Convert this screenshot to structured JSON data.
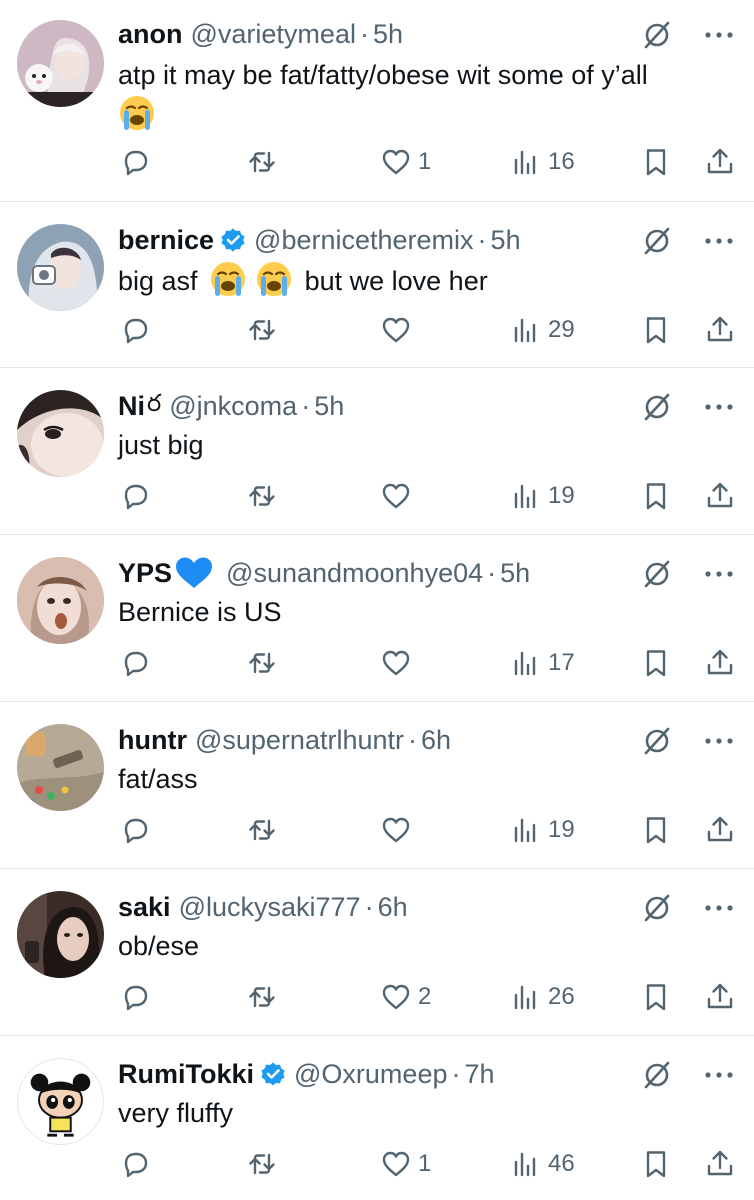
{
  "tweets": [
    {
      "name": "anon",
      "verified": false,
      "name_extra": "",
      "handle": "@varietymeal",
      "time": "5h",
      "text_parts": [
        "atp it may be fat/fatty/obese wit some of y’all"
      ],
      "emojis_inline": [],
      "emoji_line": "crying-face",
      "likes": "1",
      "views": "16",
      "avatar_icon": "girl-with-plush-avatar",
      "colors": {
        "bg": "#c9b7c4",
        "fg": "#ede3e6"
      }
    },
    {
      "name": "bernice",
      "verified": true,
      "name_extra": "",
      "handle": "@berniceth​eremix",
      "time": "5h",
      "text_parts": [
        "big asf",
        "but we love her"
      ],
      "emojis_inline": [
        "crying-face",
        "crying-face"
      ],
      "emoji_line": "",
      "likes": "",
      "views": "29",
      "avatar_icon": "hooded-girl-avatar",
      "colors": {
        "bg": "#8aa0b3",
        "fg": "#e8edf1"
      }
    },
    {
      "name": "Ni",
      "verified": false,
      "name_extra": "ర",
      "handle": "@jnkcoma",
      "time": "5h",
      "text_parts": [
        "just big"
      ],
      "emojis_inline": [],
      "emoji_line": "",
      "likes": "",
      "views": "19",
      "avatar_icon": "closeup-face-avatar",
      "colors": {
        "bg": "#d9c6c0",
        "fg": "#f3e7e2"
      }
    },
    {
      "name": "YPS",
      "verified": false,
      "name_extra": "",
      "name_heart": true,
      "handle": "@sunandmoonhye04",
      "time": "5h",
      "text_parts": [
        "Bernice is US"
      ],
      "emojis_inline": [],
      "emoji_line": "",
      "likes": "",
      "views": "17",
      "avatar_icon": "selfie-avatar",
      "colors": {
        "bg": "#c3a79b",
        "fg": "#f0e0d8"
      }
    },
    {
      "name": "huntr",
      "verified": false,
      "name_extra": "",
      "handle": "@supernatrlhuntr",
      "time": "6h",
      "text_parts": [
        "fat/ass"
      ],
      "emojis_inline": [],
      "emoji_line": "",
      "likes": "",
      "views": "19",
      "avatar_icon": "toys-avatar",
      "colors": {
        "bg": "#b9ab99",
        "fg": "#d6cbb9"
      }
    },
    {
      "name": "saki",
      "verified": false,
      "name_extra": "",
      "handle": "@luckysaki777",
      "time": "6h",
      "text_parts": [
        "ob/ese"
      ],
      "emojis_inline": [],
      "emoji_line": "",
      "likes": "2",
      "views": "26",
      "avatar_icon": "dark-hair-avatar",
      "colors": {
        "bg": "#3a2b27",
        "fg": "#c9a995"
      }
    },
    {
      "name": "RumiTokki",
      "verified": true,
      "name_extra": "",
      "handle": "@Oxrumeep",
      "time": "7h",
      "text_parts": [
        "very fluffy"
      ],
      "emojis_inline": [],
      "emoji_line": "",
      "likes": "1",
      "views": "46",
      "avatar_icon": "cartoon-girl-avatar",
      "colors": {
        "bg": "#ffffff",
        "fg": "#000000"
      }
    }
  ],
  "colors": {
    "text": "#0f1419",
    "secondary": "#536471",
    "verified": "#1d9bf0",
    "divider": "#e7e9ea",
    "heart_blue": "#1d8df5"
  }
}
